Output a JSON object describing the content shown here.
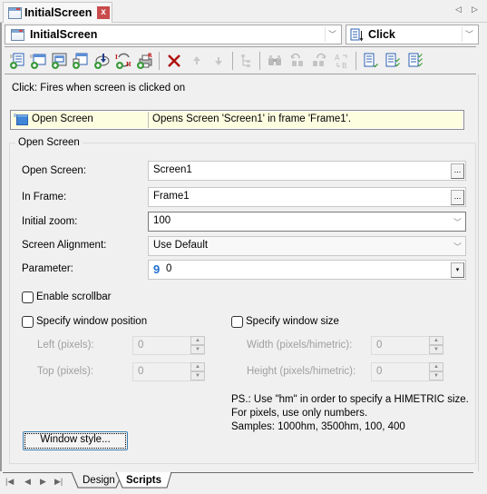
{
  "document_tab": {
    "title": "InitialScreen",
    "close_label": "x",
    "nav_left": "◁",
    "nav_right": "▷"
  },
  "object_selector": {
    "value": "InitialScreen",
    "arrow": "﹀"
  },
  "event_selector": {
    "value": "Click",
    "arrow": "﹀"
  },
  "toolbar": {
    "buttons": [
      {
        "name": "add-script",
        "enabled": true
      },
      {
        "name": "add-open-screen",
        "enabled": true
      },
      {
        "name": "add-open-frame",
        "enabled": true
      },
      {
        "name": "add-close-screen",
        "enabled": true
      },
      {
        "name": "add-download",
        "enabled": true
      },
      {
        "name": "add-switch-value",
        "enabled": true
      },
      {
        "name": "add-print",
        "enabled": true
      },
      {
        "name": "delete",
        "enabled": true
      },
      {
        "name": "move-up",
        "enabled": false
      },
      {
        "name": "move-down",
        "enabled": false
      },
      {
        "name": "tree",
        "enabled": false
      },
      {
        "name": "find",
        "enabled": false
      },
      {
        "name": "find-previous",
        "enabled": false
      },
      {
        "name": "find-next",
        "enabled": false
      },
      {
        "name": "replace",
        "enabled": false
      },
      {
        "name": "verify",
        "enabled": true
      },
      {
        "name": "verify-selected",
        "enabled": true
      },
      {
        "name": "verify-all",
        "enabled": true
      }
    ]
  },
  "event_description": "Click: Fires when screen is clicked on",
  "actions": [
    {
      "name": "Open Screen",
      "description": "Opens Screen 'Screen1' in frame 'Frame1'."
    }
  ],
  "group": {
    "title": "Open Screen",
    "fields": {
      "open_screen": {
        "label": "Open Screen:",
        "value": "Screen1",
        "button": "..."
      },
      "in_frame": {
        "label": "In Frame:",
        "value": "Frame1",
        "button": "..."
      },
      "initial_zoom": {
        "label": "Initial zoom:",
        "value": "100",
        "arrow": "﹀"
      },
      "screen_alignment": {
        "label": "Screen Alignment:",
        "value": "Use Default",
        "arrow": "﹀"
      },
      "parameter": {
        "label": "Parameter:",
        "icon": "9",
        "value": "0",
        "button": "▾"
      }
    },
    "enable_scrollbar": {
      "label": "Enable scrollbar",
      "checked": false
    },
    "window_position": {
      "label": "Specify window position",
      "checked": false,
      "left": {
        "label": "Left (pixels):",
        "value": "0"
      },
      "top": {
        "label": "Top (pixels):",
        "value": "0"
      }
    },
    "window_size": {
      "label": "Specify window size",
      "checked": false,
      "width": {
        "label": "Width (pixels/himetric):",
        "value": "0"
      },
      "height": {
        "label": "Height (pixels/himetric):",
        "value": "0"
      }
    },
    "note": {
      "line1": "PS.: Use \"hm\" in order to specify a HIMETRIC size.",
      "line2": "For pixels, use only numbers.",
      "line3": "Samples: 1000hm, 3500hm, 100, 400"
    },
    "window_style_button": "Window style..."
  },
  "spin": {
    "up": "▲",
    "down": "▼"
  },
  "bottom_tabs": {
    "nav": {
      "first": "|◀",
      "prev": "◀",
      "next": "▶",
      "last": "▶|"
    },
    "tabs": [
      {
        "label": "Design",
        "active": false
      },
      {
        "label": "Scripts",
        "active": true
      }
    ]
  },
  "colors": {
    "action_row_bg": "#fdfde0",
    "close_button": "#c94b4b",
    "delete_icon": "#b01010",
    "parameter_icon": "#1f6fd0"
  }
}
